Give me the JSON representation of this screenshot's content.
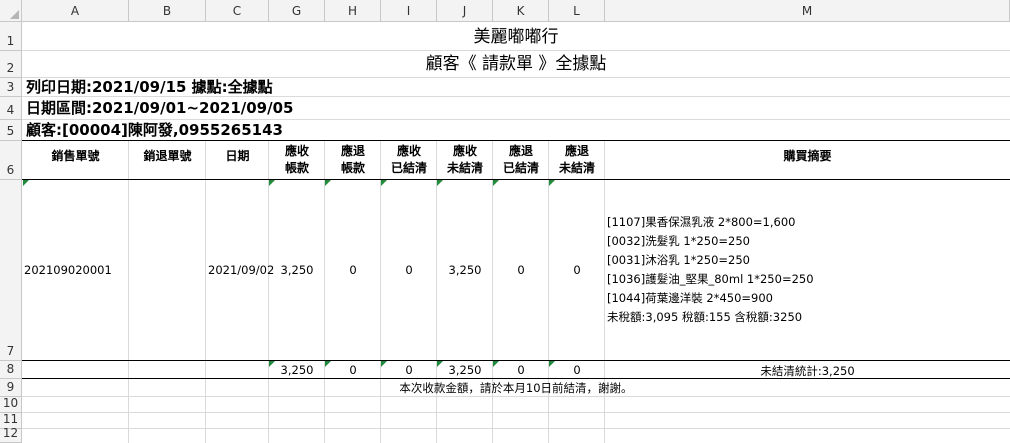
{
  "columns": [
    "A",
    "B",
    "C",
    "G",
    "H",
    "I",
    "J",
    "K",
    "L",
    "M"
  ],
  "rows": [
    "1",
    "2",
    "3",
    "4",
    "5",
    "6",
    "7",
    "8",
    "9",
    "10",
    "11",
    "12"
  ],
  "title": "美麗嘟嘟行",
  "subtitle": "顧客《 請款單 》全據點",
  "print_info": "列印日期:2021/09/15 據點:全據點",
  "date_range": "日期區間:2021/09/01~2021/09/05",
  "customer": "顧客:[00004]陳阿發,0955265143",
  "headers": {
    "sales_no": "銷售單號",
    "return_no": "銷退單號",
    "date": "日期",
    "recv_1": "應收",
    "recv_2": "帳款",
    "ret_1": "應退",
    "ret_2": "帳款",
    "recv_settled_1": "應收",
    "recv_settled_2": "已結清",
    "recv_unsettled_1": "應收",
    "recv_unsettled_2": "未結清",
    "ret_settled_1": "應退",
    "ret_settled_2": "已結清",
    "ret_unsettled_1": "應退",
    "ret_unsettled_2": "未結清",
    "summary": "購買摘要"
  },
  "record": {
    "sales_no": "202109020001",
    "date": "2021/09/02",
    "receivable": "3,250",
    "refundable": "0",
    "recv_settled": "0",
    "recv_unsettled": "3,250",
    "ret_settled": "0",
    "ret_unsettled": "0",
    "summary_lines": [
      "[1107]果香保濕乳液 2*800=1,600",
      "[0032]洗髮乳 1*250=250",
      "[0031]沐浴乳 1*250=250",
      "[1036]護髮油_堅果_80ml 1*250=250",
      "[1044]荷葉邊洋裝 2*450=900",
      "未稅額:3,095 稅額:155 含稅額:3250"
    ]
  },
  "totals": {
    "receivable": "3,250",
    "refundable": "0",
    "recv_settled": "0",
    "recv_unsettled": "3,250",
    "ret_settled": "0",
    "ret_unsettled": "0",
    "unsettled_summary": "未結清統計:3,250"
  },
  "footer_note": "本次收款金額，請於本月10日前結清，謝謝。",
  "colors": {
    "header_bg": "#f3f3f3",
    "gridline": "#dadada",
    "comment_marker": "#1e8a3a"
  }
}
